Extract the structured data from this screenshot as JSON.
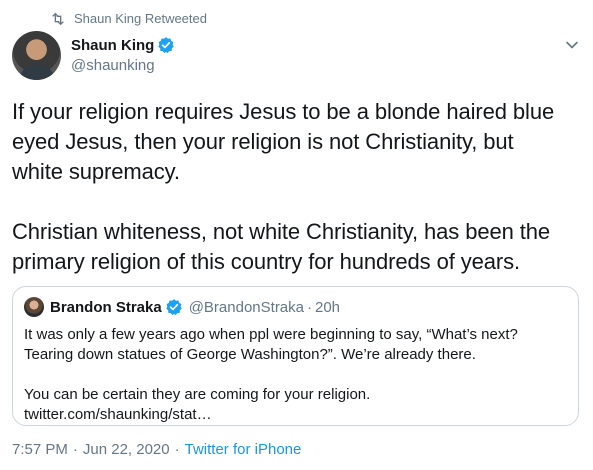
{
  "retweet": {
    "label": "Shaun King Retweeted"
  },
  "author": {
    "name": "Shaun King",
    "handle": "@shaunking"
  },
  "tweet": {
    "text": "If your religion requires Jesus to be a blonde haired blue\neyed Jesus, then your religion is not Christianity, but\nwhite supremacy.\n\nChristian whiteness, not white Christianity, has been the\nprimary religion of this country for hundreds of years."
  },
  "quote": {
    "name": "Brandon Straka",
    "handle": "@BrandonStraka",
    "separator": "·",
    "time": "20h",
    "text": "It was only a few years ago when ppl were beginning to say, “What’s next?\nTearing down statues of George Washington?”. We’re already there.\n\nYou can be certain they are coming for your religion.\ntwitter.com/shaunking/stat…"
  },
  "footer": {
    "time": "7:57 PM",
    "separator": "·",
    "date": "Jun 22, 2020",
    "separator2": "·",
    "source": "Twitter for iPhone"
  },
  "icons": {
    "retweet": "retweet-icon",
    "verified": "verified-badge-icon",
    "chevron": "chevron-down-icon"
  },
  "colors": {
    "accent": "#1da1f2",
    "secondary_text": "#657786",
    "link": "#1b95e0",
    "border": "#ccd6dd"
  }
}
